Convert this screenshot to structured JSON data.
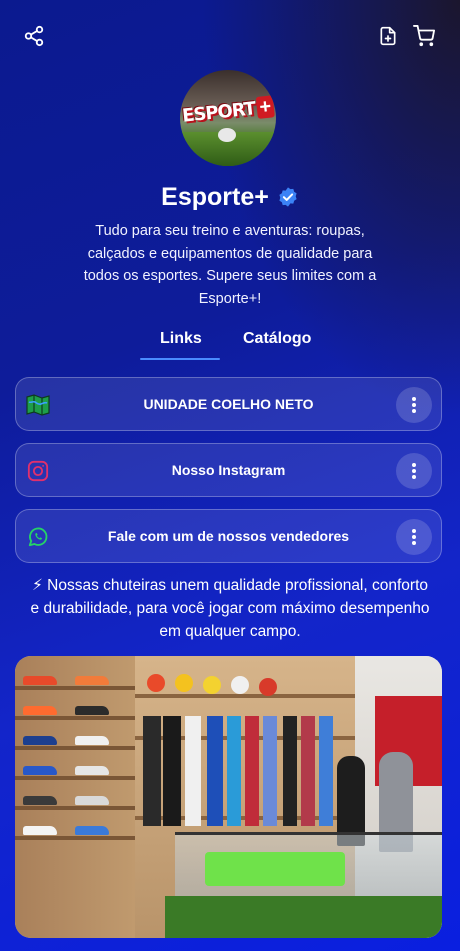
{
  "header": {
    "share_icon": "share-icon",
    "document_icon": "document-icon",
    "cart_icon": "cart-icon"
  },
  "profile": {
    "avatar_logo_text": "ESPORT",
    "avatar_logo_plus": "+",
    "name": "Esporte+",
    "verified_icon": "verified-badge-icon",
    "bio": "Tudo para seu treino e aventuras: roupas, calçados e equipamentos de qualidade para todos os esportes. Supere seus limites com a Esporte+!"
  },
  "tabs": [
    {
      "label": "Links",
      "active": true
    },
    {
      "label": "Catálogo",
      "active": false
    }
  ],
  "links": [
    {
      "label": "UNIDADE COELHO NETO",
      "icon": "map-icon"
    },
    {
      "label": "Nosso Instagram",
      "icon": "instagram-icon"
    },
    {
      "label": "Fale com um de nossos vendedores",
      "icon": "whatsapp-icon"
    }
  ],
  "more_icon": "more-vertical-icon",
  "promo_text": "⚡ Nossas chuteiras unem qualidade profissional, conforto e durabilidade, para você jogar com máximo desempenho em qualquer campo.",
  "colors": {
    "accent": "#4a8cff",
    "verified": "#3b82f6",
    "instagram": "#e1306c",
    "whatsapp": "#25d366"
  }
}
